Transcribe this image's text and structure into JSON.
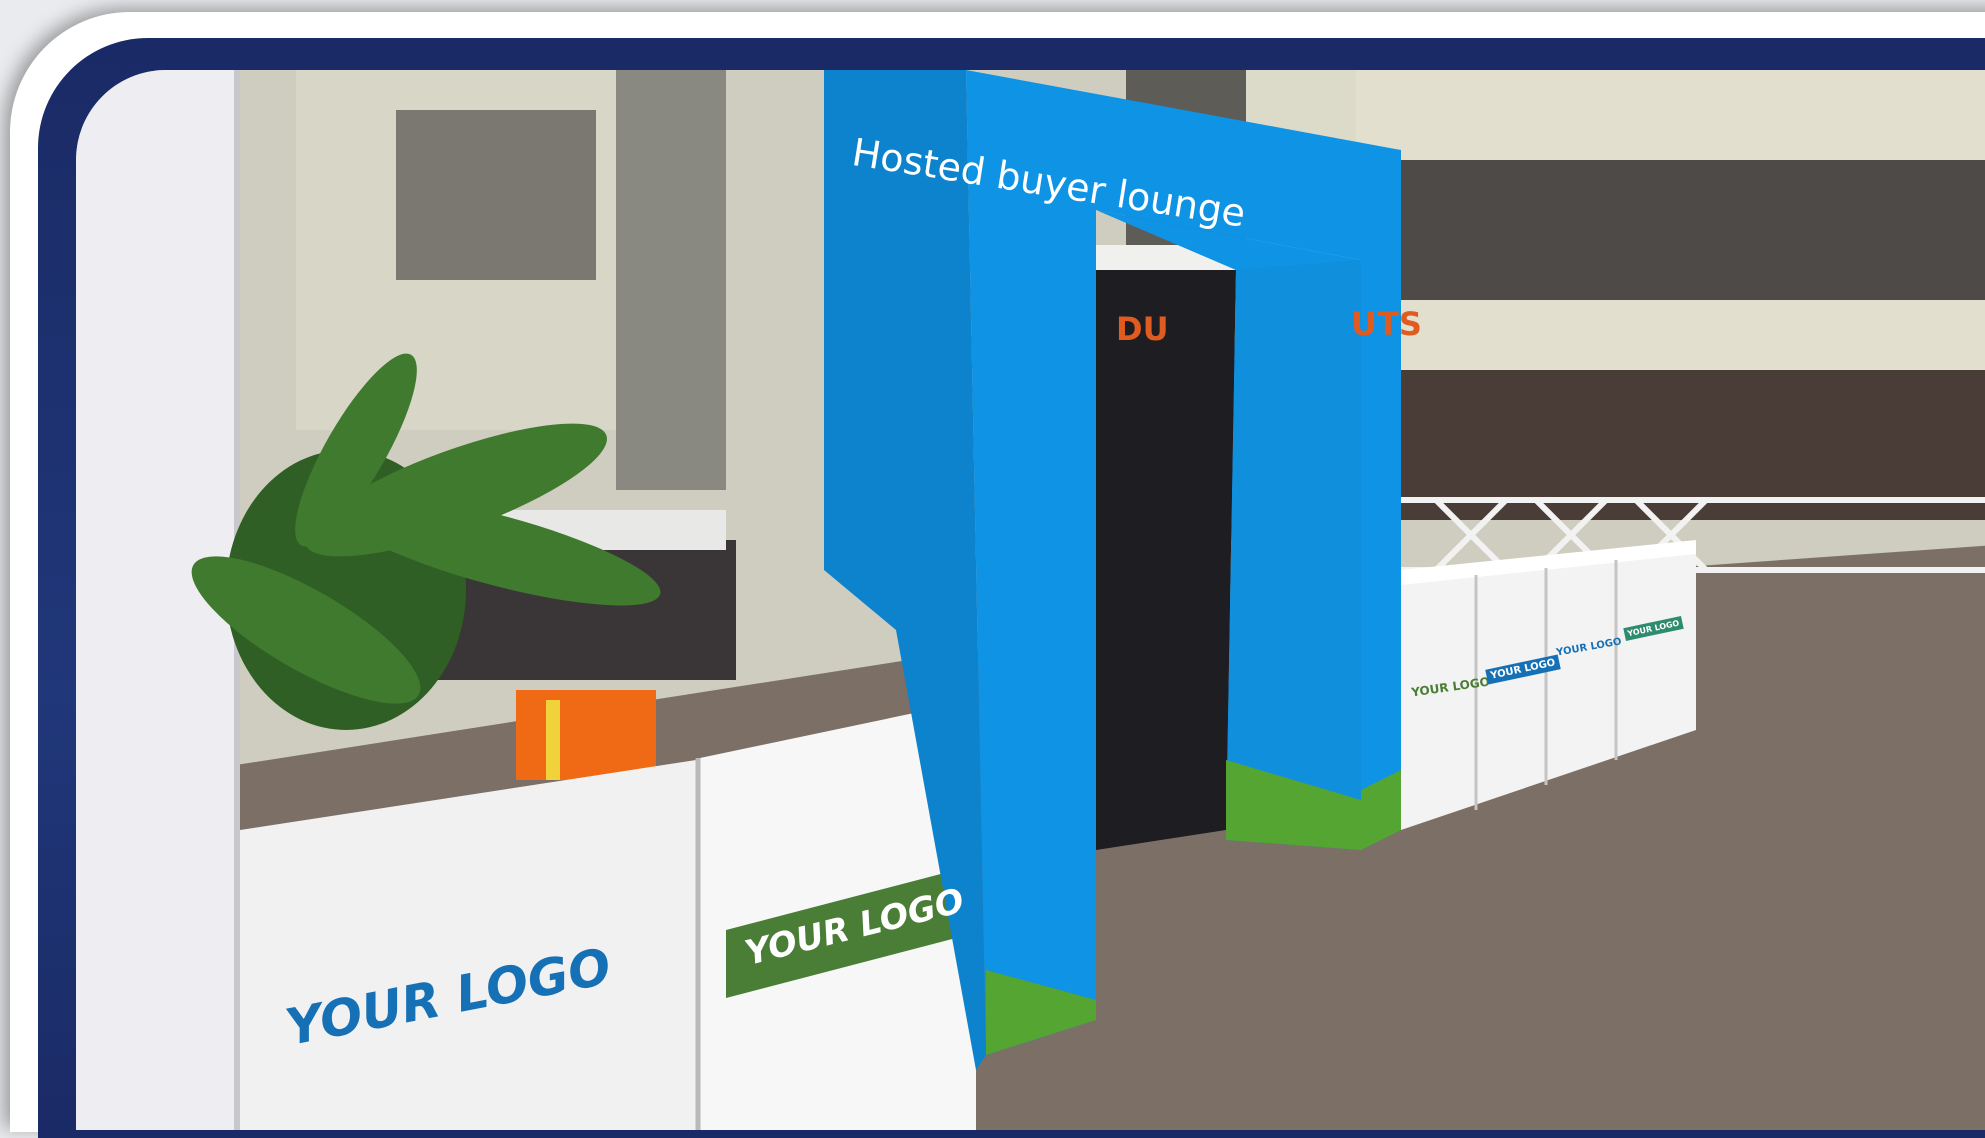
{
  "scene": {
    "arch_sign": "Hosted buyer lounge",
    "panel_logo_blue": "YOUR LOGO",
    "panel_logo_green": "YOUR LOGO",
    "counter_logos": [
      "YOUR LOGO",
      "YOUR LOGO",
      "YOUR LOGO",
      "YOUR LOGO"
    ],
    "shop_sign_left": "DU",
    "shop_sign_right": "UTS"
  },
  "colors": {
    "navy_frame": "#1a2a66",
    "arch_blue": "#0f93e4",
    "brand_green": "#54a531",
    "logo_blue": "#1670b5",
    "logo_green_bg": "#4a7d36",
    "carpet": "#7b6f66"
  }
}
